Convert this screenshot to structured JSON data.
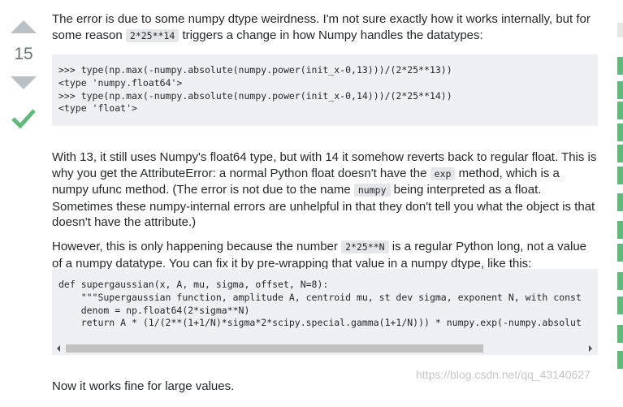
{
  "vote": {
    "count": "15",
    "accepted": true
  },
  "answer": {
    "p1_before": "The error is due to some numpy dtype weirdness. I'm not sure exactly how it works internally, but for some reason ",
    "p1_code": "2*25**14",
    "p1_after": " triggers a change in how Numpy handles the datatypes:",
    "code1": ">>> type(np.max(-numpy.absolute(numpy.power(init_x-0,13)))/(2*25**13))\n<type 'numpy.float64'>\n>>> type(np.max(-numpy.absolute(numpy.power(init_x-0,14)))/(2*25**14))\n<type 'float'>",
    "p2_a": "With 13, it still uses Numpy's float64 type, but with 14 it somehow reverts back to regular float. This is why you get the AttributeError: a normal Python float doesn't have the ",
    "p2_code1": "exp",
    "p2_b": " method, which is a numpy ufunc method. (The error is not due to the name ",
    "p2_code2": "numpy",
    "p2_c": " being interpreted as a float. Sometimes these numpy-internal errors are unhelpful in that they don't tell you what the object is that doesn't have the attribute.)",
    "p3_a": "However, this is only happening because the number ",
    "p3_code": "2*25**N",
    "p3_b": " is a regular Python long, not a value of a numpy datatype. You can fix it by pre-wrapping that value in a numpy dtype, like this:",
    "code2": "def supergaussian(x, A, mu, sigma, offset, N=8):\n    \"\"\"Supergaussian function, amplitude A, centroid mu, st dev sigma, exponent N, with const\n    denom = np.float64(2*sigma**N)\n    return A * (1/(2**(1+1/N)*sigma*2*scipy.special.gamma(1+1/N))) * numpy.exp(-numpy.absolut",
    "p4": "Now it works fine for large values."
  },
  "watermark": "https://blog.csdn.net/qq_43140627",
  "colors": {
    "accepted": "#5eba7d",
    "vote_arrow": "#bbc0c4",
    "code_bg": "#eff0f1"
  }
}
